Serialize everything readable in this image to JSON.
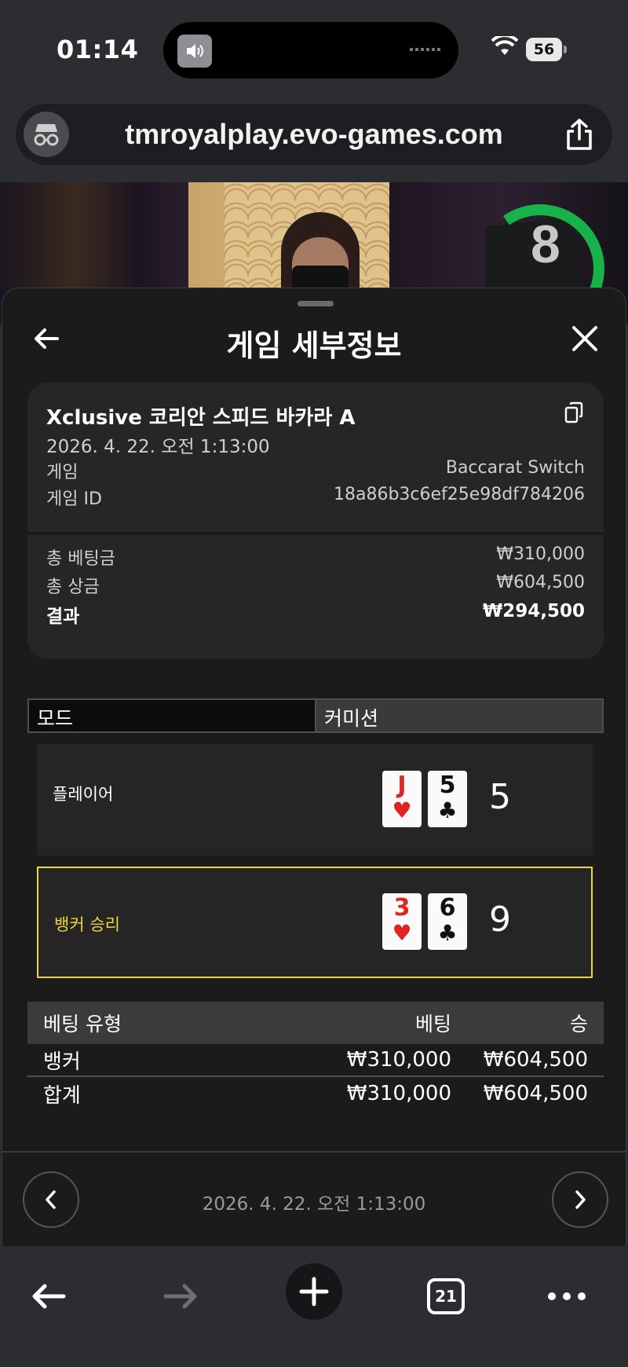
{
  "status": {
    "time": "01:14",
    "battery": "56"
  },
  "browser": {
    "url": "tmroyalplay.evo-games.com",
    "tab_count": "21"
  },
  "video": {
    "timer": "8"
  },
  "sheet": {
    "title": "게임 세부정보",
    "game_name": "Xclusive 코리안 스피드 바카라 A",
    "date": "2026. 4. 22. 오전 1:13:00",
    "game_label": "게임",
    "game_value": "Baccarat Switch",
    "game_id_label": "게임 ID",
    "game_id_value": "18a86b3c6ef25e98df784206",
    "total_bet_label": "총 베팅금",
    "total_bet_value": "₩310,000",
    "total_win_label": "총 상금",
    "total_win_value": "₩604,500",
    "result_label": "결과",
    "result_value": "₩294,500"
  },
  "mode": {
    "left": "모드",
    "right": "커미션"
  },
  "hands": {
    "player": {
      "label": "플레이어",
      "cards": [
        {
          "rank": "J",
          "suit": "♥"
        },
        {
          "rank": "5",
          "suit": "♣"
        }
      ],
      "score": "5"
    },
    "banker": {
      "label": "뱅커 승리",
      "cards": [
        {
          "rank": "3",
          "suit": "♥"
        },
        {
          "rank": "6",
          "suit": "♣"
        }
      ],
      "score": "9"
    }
  },
  "bets": {
    "headers": {
      "type": "베팅 유형",
      "bet": "베팅",
      "win": "승"
    },
    "rows": [
      {
        "type": "뱅커",
        "bet": "₩310,000",
        "win": "₩604,500"
      }
    ],
    "total": {
      "type": "합계",
      "bet": "₩310,000",
      "win": "₩604,500"
    }
  },
  "nav": {
    "date": "2026. 4. 22. 오전 1:13:00"
  },
  "colors": {
    "accent_yellow": "#f1d42a",
    "timer_green": "#17b24a",
    "card_red": "#e02424"
  }
}
